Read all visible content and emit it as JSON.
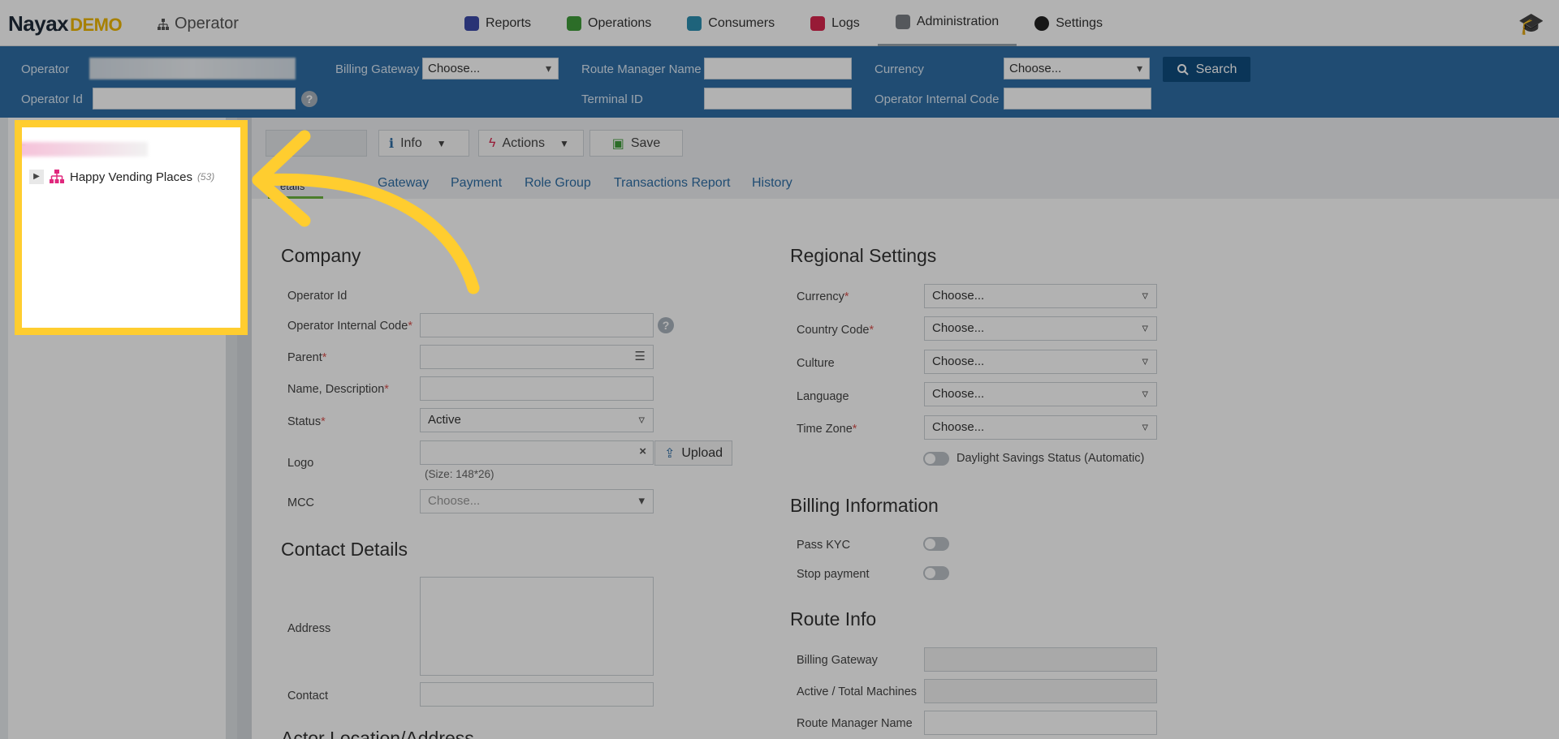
{
  "topnav": {
    "logo_main": "Nayax",
    "logo_accent": "DEMO",
    "app_name": "Operator",
    "items": [
      {
        "label": "Reports",
        "icon": "reports-icon",
        "color": "#3b4aa8"
      },
      {
        "label": "Operations",
        "icon": "operations-icon",
        "color": "#3f9c3a"
      },
      {
        "label": "Consumers",
        "icon": "consumers-icon",
        "color": "#2b8fb0"
      },
      {
        "label": "Logs",
        "icon": "logs-icon",
        "color": "#d9264e"
      },
      {
        "label": "Administration",
        "icon": "administration-icon",
        "color": "#7a7f85"
      },
      {
        "label": "Settings",
        "icon": "settings-icon",
        "color": "#222222"
      }
    ]
  },
  "search": {
    "operator_label": "Operator",
    "operator_id_label": "Operator Id",
    "billing_gateway_label": "Billing Gateway",
    "billing_gateway_value": "Choose...",
    "route_manager_label": "Route Manager Name",
    "terminal_id_label": "Terminal ID",
    "currency_label": "Currency",
    "currency_value": "Choose...",
    "internal_code_label": "Operator Internal Code",
    "search_button": "Search"
  },
  "tree": {
    "node_label": "Happy Vending Places",
    "node_count": "(53)"
  },
  "toolbar": {
    "info": "Info",
    "actions": "Actions",
    "save": "Save"
  },
  "tabs": [
    "Gateway",
    "Payment",
    "Role Group",
    "Transactions Report",
    "History"
  ],
  "tab_active_partial": "etails",
  "company": {
    "title": "Company",
    "operator_id": "Operator Id",
    "internal_code": "Operator Internal Code",
    "parent": "Parent",
    "name_desc": "Name, Description",
    "status": "Status",
    "status_value": "Active",
    "logo": "Logo",
    "upload": "Upload",
    "logo_hint": "(Size: 148*26)",
    "mcc": "MCC",
    "mcc_placeholder": "Choose..."
  },
  "contact": {
    "title": "Contact Details",
    "address": "Address",
    "contact": "Contact",
    "next_section_partial": "Actor Location/Address"
  },
  "regional": {
    "title": "Regional Settings",
    "currency": "Currency",
    "country_code": "Country Code",
    "culture": "Culture",
    "language": "Language",
    "time_zone": "Time Zone",
    "choose": "Choose...",
    "daylight": "Daylight Savings Status (Automatic)"
  },
  "billing": {
    "title": "Billing Information",
    "pass_kyc": "Pass KYC",
    "stop_payment": "Stop payment"
  },
  "route": {
    "title": "Route Info",
    "billing_gateway": "Billing Gateway",
    "machines": "Active / Total Machines",
    "route_manager": "Route Manager Name"
  },
  "colors": {
    "search_band": "#2e6ea5",
    "highlight": "#ffcd2f",
    "link": "#2e6ea5"
  }
}
